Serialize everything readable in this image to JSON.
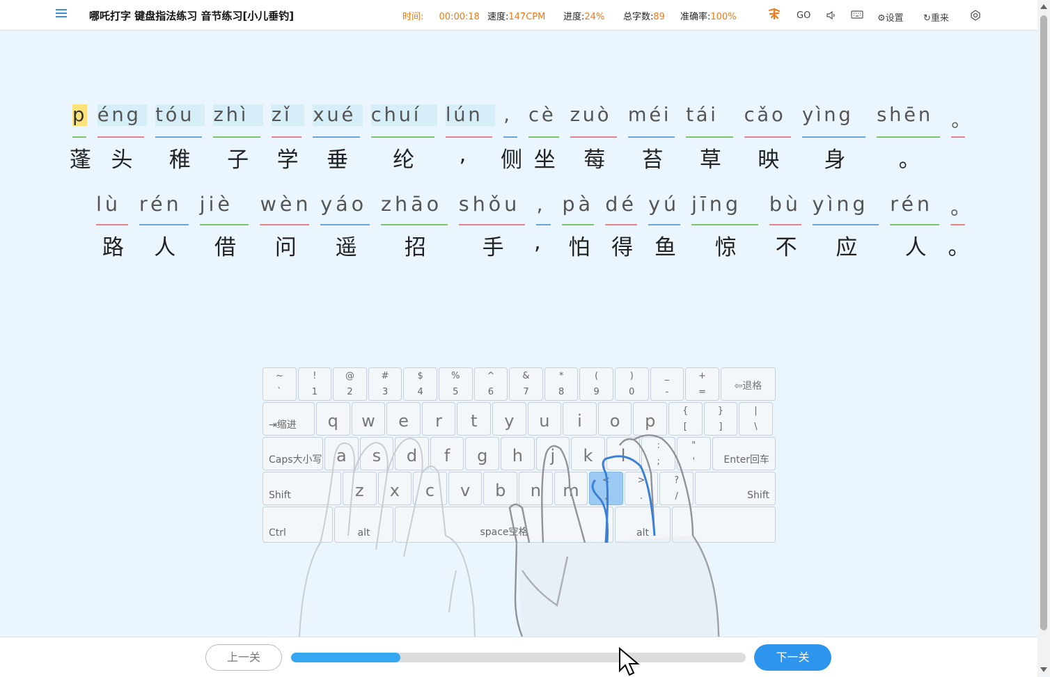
{
  "header": {
    "title": "哪吒打字 键盘指法练习 音节练习[小儿垂钓]",
    "time_label": "时间:",
    "time_value": "00:00:18",
    "speed_label": "速度:",
    "speed_value": "147CPM",
    "progress_label": "进度:",
    "progress_value": "24%",
    "total_label": "总字数:",
    "total_value": "89",
    "accuracy_label": "准确率:",
    "accuracy_value": "100%",
    "go_label": "GO",
    "settings_label": "设置",
    "restart_label": "重来"
  },
  "lines": [
    {
      "pinyin": [
        {
          "text": "p",
          "state": "current"
        },
        {
          "text": "éng",
          "state": "typed"
        },
        {
          "text": "tóu",
          "state": "typed"
        },
        {
          "text": "zhì",
          "state": "typed"
        },
        {
          "text": "zǐ",
          "state": "typed"
        },
        {
          "text": "xué",
          "state": "typed"
        },
        {
          "text": "chuí",
          "state": "typed"
        },
        {
          "text": "lún",
          "state": "typed"
        },
        {
          "text": ",",
          "state": "pending"
        },
        {
          "text": "cè",
          "state": "pending"
        },
        {
          "text": "zuò",
          "state": "pending"
        },
        {
          "text": "méi",
          "state": "pending"
        },
        {
          "text": "tái",
          "state": "pending"
        },
        {
          "text": "cǎo",
          "state": "pending"
        },
        {
          "text": "yìng",
          "state": "pending"
        },
        {
          "text": "shēn",
          "state": "pending"
        },
        {
          "text": "。",
          "state": "pending"
        }
      ],
      "hanzi": [
        "蓬",
        "头",
        "稚",
        "子",
        "学",
        "垂",
        "纶",
        ",",
        "侧",
        "坐",
        "莓",
        "苔",
        "草",
        "映",
        "身",
        "。"
      ]
    },
    {
      "pinyin": [
        {
          "text": "lù",
          "state": "pending"
        },
        {
          "text": "rén",
          "state": "pending"
        },
        {
          "text": "jiè",
          "state": "pending"
        },
        {
          "text": "wèn",
          "state": "pending"
        },
        {
          "text": "yáo",
          "state": "pending"
        },
        {
          "text": "zhāo",
          "state": "pending"
        },
        {
          "text": "shǒu",
          "state": "pending"
        },
        {
          "text": ",",
          "state": "pending"
        },
        {
          "text": "pà",
          "state": "pending"
        },
        {
          "text": "dé",
          "state": "pending"
        },
        {
          "text": "yú",
          "state": "pending"
        },
        {
          "text": "jīng",
          "state": "pending"
        },
        {
          "text": "bù",
          "state": "pending"
        },
        {
          "text": "yìng",
          "state": "pending"
        },
        {
          "text": "rén",
          "state": "pending"
        },
        {
          "text": "。",
          "state": "pending"
        }
      ],
      "hanzi": [
        "路",
        "人",
        "借",
        "问",
        "遥",
        "招",
        "手",
        ",",
        "怕",
        "得",
        "鱼",
        "惊",
        "不",
        "应",
        "人",
        "。"
      ]
    }
  ],
  "keyboard": {
    "row1": [
      {
        "top": "~",
        "bot": "`"
      },
      {
        "top": "!",
        "bot": "1"
      },
      {
        "top": "@",
        "bot": "2"
      },
      {
        "top": "#",
        "bot": "3"
      },
      {
        "top": "$",
        "bot": "4"
      },
      {
        "top": "%",
        "bot": "5"
      },
      {
        "top": "^",
        "bot": "6"
      },
      {
        "top": "&",
        "bot": "7"
      },
      {
        "top": "*",
        "bot": "8"
      },
      {
        "top": "(",
        "bot": "9"
      },
      {
        "top": ")",
        "bot": "0"
      },
      {
        "top": "_",
        "bot": "-"
      },
      {
        "top": "+",
        "bot": "="
      }
    ],
    "backspace": "⇦退格",
    "tab": "⇥缩进",
    "row2": [
      "q",
      "w",
      "e",
      "r",
      "t",
      "y",
      "u",
      "i",
      "o",
      "p"
    ],
    "row2_sym": [
      {
        "top": "{",
        "bot": "["
      },
      {
        "top": "}",
        "bot": "]"
      },
      {
        "top": "|",
        "bot": "\\"
      }
    ],
    "caps": "Caps大小写",
    "row3": [
      "a",
      "s",
      "d",
      "f",
      "g",
      "h",
      "j",
      "k",
      "l"
    ],
    "row3_sym": [
      {
        "top": ":",
        "bot": ";"
      },
      {
        "top": "\"",
        "bot": "'"
      }
    ],
    "enter": "Enter回车",
    "shift_left": "Shift",
    "row4": [
      "z",
      "x",
      "c",
      "v",
      "b",
      "n",
      "m"
    ],
    "row4_sym": [
      {
        "top": "<",
        "bot": ","
      },
      {
        "top": ">",
        "bot": "."
      },
      {
        "top": "?",
        "bot": "/"
      }
    ],
    "shift_right": "Shift",
    "ctrl": "Ctrl",
    "alt_left": "alt",
    "space": "space空格",
    "alt_right": "alt",
    "active_key": ","
  },
  "footer": {
    "prev_label": "上一关",
    "next_label": "下一关",
    "progress_fraction": 0.24
  },
  "colors": {
    "accent": "#2d95ee",
    "stat_value": "#f07a1a",
    "current_char": "#ffe27a",
    "typed_bg": "#d6eef7",
    "underline_green": "#7cc36b",
    "underline_red": "#e2838c",
    "underline_blue": "#6aa3e4"
  }
}
